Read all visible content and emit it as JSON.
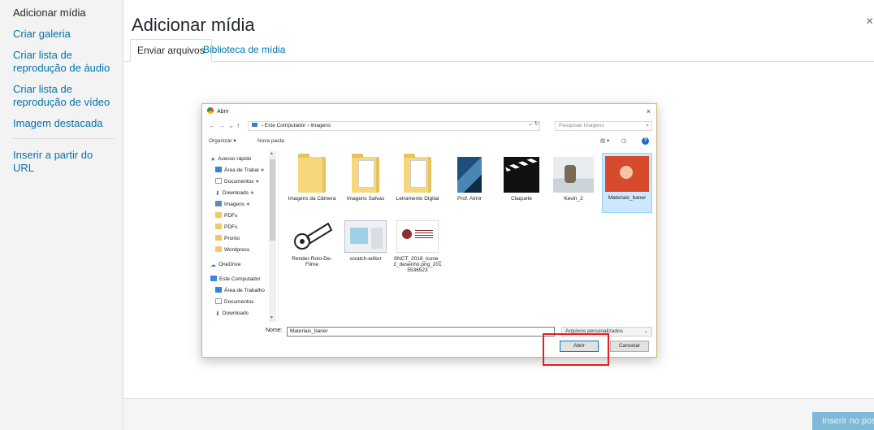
{
  "sidebar": {
    "items": [
      {
        "label": "Adicionar mídia"
      },
      {
        "label": "Criar galeria"
      },
      {
        "label": "Criar lista de reprodução de áudio"
      },
      {
        "label": "Criar lista de reprodução de vídeo"
      },
      {
        "label": "Imagem destacada"
      },
      {
        "label": "Inserir a partir do URL"
      }
    ]
  },
  "modal": {
    "title": "Adicionar mídia",
    "close": "×",
    "tabs": [
      {
        "label": "Enviar arquivos"
      },
      {
        "label": "Biblioteca de mídia"
      }
    ],
    "insert_button": "Inserir no post"
  },
  "dialog": {
    "title": "Abrir",
    "close": "×",
    "nav_back": "←",
    "nav_forward": "→",
    "nav_recent": "⌄",
    "nav_up": "↑",
    "breadcrumb": [
      "Este Computador",
      "Imagens"
    ],
    "breadcrumb_sep": "›",
    "refresh": "⌄  ↻",
    "search_placeholder": "Pesquisar Imagens",
    "search_icon": "⌕",
    "toolbar": {
      "organize": "Organizar ▾",
      "new_folder": "Nova pasta",
      "view": "▤ ▾",
      "pane": "◫",
      "help": "?"
    },
    "nav_items": [
      {
        "label": "Acesso rápido",
        "icon": "star"
      },
      {
        "label": "Área de Trabal",
        "icon": "desktop",
        "pinned": true
      },
      {
        "label": "Documentos",
        "icon": "documents",
        "pinned": true
      },
      {
        "label": "Downloads",
        "icon": "downloads",
        "pinned": true
      },
      {
        "label": "Imagens",
        "icon": "pictures",
        "pinned": true
      },
      {
        "label": "PDFs",
        "icon": "folder"
      },
      {
        "label": "PDFs",
        "icon": "folder"
      },
      {
        "label": "Pronto",
        "icon": "folder"
      },
      {
        "label": "Wordpress",
        "icon": "folder"
      },
      {
        "label": "OneDrive",
        "icon": "cloud"
      },
      {
        "label": "Este Computador",
        "icon": "pc"
      },
      {
        "label": "Área de Trabalho",
        "icon": "desktop"
      },
      {
        "label": "Documentos",
        "icon": "documents"
      },
      {
        "label": "Downloads",
        "icon": "downloads"
      }
    ],
    "pin_glyph": "✱",
    "files": [
      {
        "label": "",
        "kind": "folder"
      },
      {
        "label": "",
        "kind": "folder-paper"
      },
      {
        "label": "",
        "kind": "folder-paper"
      },
      {
        "label": "",
        "kind": "book"
      },
      {
        "label": "",
        "kind": "clapper"
      },
      {
        "label": "",
        "kind": "photo"
      },
      {
        "label": "",
        "kind": "photo"
      }
    ],
    "file_labels_row1": [
      "Imagens da Câmera",
      "Imagens Salvas",
      "Letramento Digital",
      "Prof. Almir",
      "Claquete",
      "Kevin_2",
      "Materiais_baner"
    ],
    "file_labels_row2": [
      "Render-Rolo-De-Filme",
      "scratch-editor",
      "SNCT_2018_icone_2_desenho.png_2015536523"
    ],
    "name_label": "Nome:",
    "name_value": "Materiais_baner",
    "filter_value": "Arquivos personalizados",
    "filter_dropdown": "⌄",
    "open_button": "Abrir",
    "cancel_button": "Cancelar"
  },
  "colors": {
    "accent": "#0073aa",
    "highlight": "#e02020",
    "selected": "#cce8ff"
  }
}
